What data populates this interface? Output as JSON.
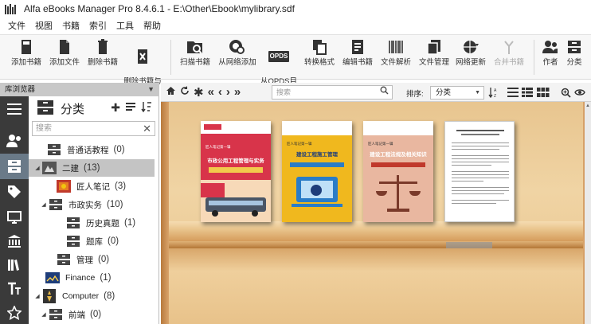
{
  "window": {
    "title": "Alfa eBooks Manager Pro 8.4.6.1 - E:\\Other\\Ebook\\mylibrary.sdf"
  },
  "menu": [
    "文件",
    "视图",
    "书籍",
    "索引",
    "工具",
    "帮助"
  ],
  "toolbar": {
    "buttons": [
      {
        "label": "添加书籍",
        "icon": "add-book-icon"
      },
      {
        "label": "添加文件",
        "icon": "add-file-icon"
      },
      {
        "label": "删除书籍",
        "icon": "delete-book-icon"
      },
      {
        "label": "删除书籍与\n文件",
        "icon": "delete-book-file-icon"
      },
      {
        "label": "扫描书籍",
        "icon": "scan-books-icon"
      },
      {
        "label": "从网络添加",
        "icon": "add-from-web-icon"
      },
      {
        "label": "从OPDS目\n录添加",
        "icon": "opds-icon",
        "badge": "OPDS"
      },
      {
        "label": "转换格式",
        "icon": "convert-icon"
      },
      {
        "label": "编辑书籍",
        "icon": "edit-book-icon"
      },
      {
        "label": "文件解析",
        "icon": "barcode-icon"
      },
      {
        "label": "文件管理",
        "icon": "file-manage-icon"
      },
      {
        "label": "网络更新",
        "icon": "web-update-icon"
      },
      {
        "label": "合并书籍",
        "icon": "merge-icon",
        "disabled": true
      },
      {
        "label": "作者",
        "icon": "authors-icon"
      },
      {
        "label": "分类",
        "icon": "categories-icon"
      }
    ]
  },
  "library_browser": {
    "header": "库浏览器",
    "panel_title": "分类",
    "search_placeholder": "搜索",
    "tree": [
      {
        "label": "普通话教程",
        "count": "(0)",
        "level": 1
      },
      {
        "label": "二建",
        "count": "(13)",
        "level": 0,
        "selected": true,
        "expanded": true
      },
      {
        "label": "匠人笔记",
        "count": "(3)",
        "level": 2
      },
      {
        "label": "市政实务",
        "count": "(10)",
        "level": 1,
        "expanded": true
      },
      {
        "label": "历史真题",
        "count": "(1)",
        "level": 3
      },
      {
        "label": "题库",
        "count": "(0)",
        "level": 3
      },
      {
        "label": "管理",
        "count": "(0)",
        "level": 2
      },
      {
        "label": "Finance",
        "count": "(1)",
        "level": 0
      },
      {
        "label": "Computer",
        "count": "(8)",
        "level": 0,
        "expanded": true
      },
      {
        "label": "前端",
        "count": "(0)",
        "level": 1
      }
    ]
  },
  "shelf_toolbar": {
    "search_placeholder": "搜索",
    "sort_label": "排序:",
    "sort_value": "分类"
  },
  "books": [
    {
      "title": "市政公用工程管理与实务",
      "top_label": "匠人笔记第一辑",
      "colors": {
        "main": "#d8344a",
        "accent": "#f2c94c"
      }
    },
    {
      "title": "建设工程施工管理",
      "top_label": "匠人笔记第一辑",
      "colors": {
        "main": "#f0b81e",
        "accent": "#2a7cc7"
      }
    },
    {
      "title": "建设工程法规及相关知识",
      "top_label": "匠人笔记第一辑",
      "colors": {
        "main": "#e07a55",
        "accent": "#f1e0d0"
      }
    },
    {
      "title": "",
      "top_label": "",
      "colors": {
        "main": "#ffffff",
        "accent": "#cccccc"
      }
    }
  ]
}
